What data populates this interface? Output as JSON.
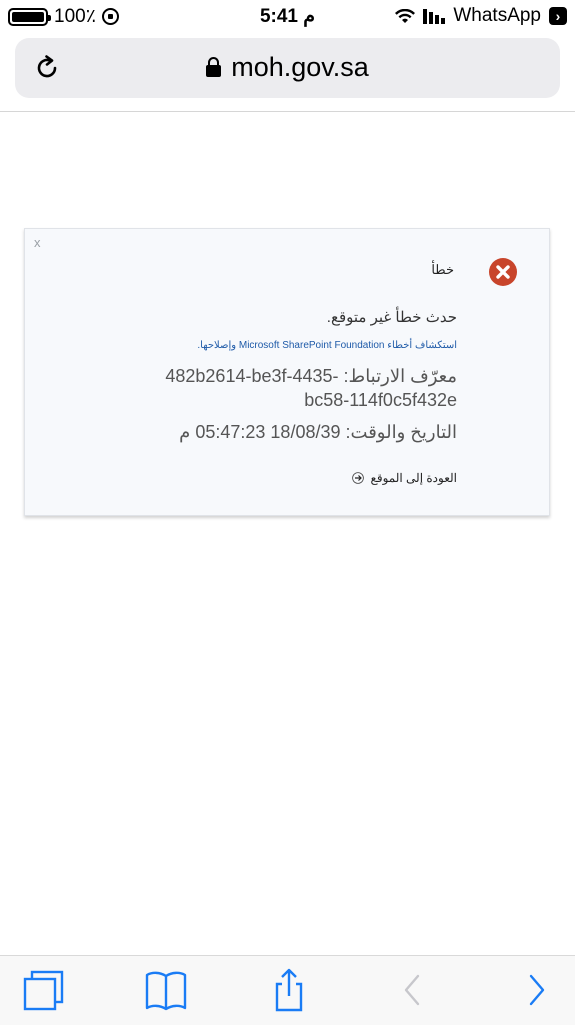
{
  "status_bar": {
    "battery_text": "100٪",
    "battery_level": 1.0,
    "time": "5:41 م",
    "carrier": "WhatsApp"
  },
  "browser": {
    "url": "moh.gov.sa"
  },
  "error": {
    "title": "خطأ",
    "message": "حدث خطأ غير متوقع.",
    "troubleshoot_link": "استكشاف أخطاء Microsoft SharePoint Foundation وإصلاحها.",
    "correlation_label": "معرّف الارتباط:",
    "correlation_id": "482b2614-be3f-4435-bc58-114f0c5f432e",
    "datetime_label": "التاريخ والوقت:",
    "datetime_value": "18/08/39 05:47:23 م",
    "back_link": "العودة إلى الموقع",
    "close_label": "x"
  },
  "toolbar": {
    "icons": [
      "tabs-icon",
      "bookmarks-icon",
      "share-icon",
      "back-arrow-icon",
      "forward-arrow-icon"
    ]
  },
  "colors": {
    "error_icon": "#c8452b",
    "link": "#1e5aa8",
    "toolbar_blue": "#1a7cf5"
  }
}
